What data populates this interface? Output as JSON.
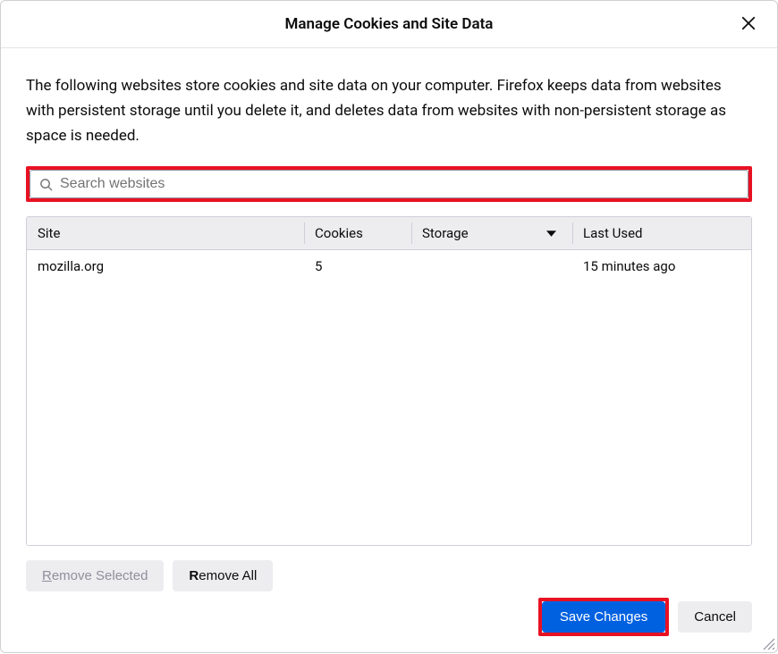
{
  "dialog": {
    "title": "Manage Cookies and Site Data",
    "description": "The following websites store cookies and site data on your computer. Firefox keeps data from websites with persistent storage until you delete it, and deletes data from websites with non-persistent storage as space is needed."
  },
  "search": {
    "placeholder": "Search websites"
  },
  "table": {
    "headers": {
      "site": "Site",
      "cookies": "Cookies",
      "storage": "Storage",
      "last_used": "Last Used"
    },
    "rows": [
      {
        "site": "mozilla.org",
        "cookies": "5",
        "storage": "",
        "last_used": "15 minutes ago"
      }
    ]
  },
  "buttons": {
    "remove_selected_prefix": "R",
    "remove_selected_rest": "emove Selected",
    "remove_all_prefix": "R",
    "remove_all_rest": "emove All",
    "save_changes": "Save Changes",
    "cancel": "Cancel"
  }
}
